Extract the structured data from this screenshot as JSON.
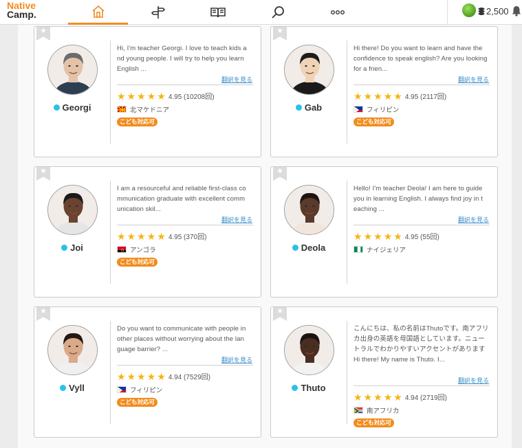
{
  "header": {
    "logo_line1": "Native",
    "logo_line2": "Camp.",
    "nav": [
      {
        "name": "home-icon",
        "active": true
      },
      {
        "name": "signpost-icon",
        "active": false
      },
      {
        "name": "book-icon",
        "active": false
      },
      {
        "name": "search-icon",
        "active": false
      },
      {
        "name": "more-icon",
        "active": false
      }
    ],
    "points": "2,500"
  },
  "teachers": [
    {
      "name": "Georgi",
      "description": "Hi, I'm teacher Georgi. I love to teach kids a nd young people. I will try to help you learn English ...",
      "translate": "翻訳を見る",
      "rating": "4.95 (10208回)",
      "country": "北マケドニア",
      "flag": "macedonia",
      "badge": "こども対応可"
    },
    {
      "name": "Gab",
      "description": "Hi there! Do you want to learn and have the confidence to speak english? Are you looking for a frien...",
      "translate": "翻訳を見る",
      "rating": "4.95 (2117回)",
      "country": "フィリピン",
      "flag": "philippines",
      "badge": "こども対応可"
    },
    {
      "name": "Joi",
      "description": "I am a resourceful and reliable first-class co mmunication graduate with excellent comm unication skil...",
      "translate": "翻訳を見る",
      "rating": "4.95 (370回)",
      "country": "アンゴラ",
      "flag": "angola",
      "badge": "こども対応可"
    },
    {
      "name": "Deola",
      "description": "Hello! I'm teacher Deola! I am here to guide you in learning English. I always find joy in t eaching ...",
      "translate": "翻訳を見る",
      "rating": "4.95 (55回)",
      "country": "ナイジェリア",
      "flag": "nigeria",
      "badge": ""
    },
    {
      "name": "Vyll",
      "description": "Do you want to communicate with people in other places without worrying about the lan guage barrier? ...",
      "translate": "翻訳を見る",
      "rating": "4.94 (7529回)",
      "country": "フィリピン",
      "flag": "philippines",
      "badge": "こども対応可"
    },
    {
      "name": "Thuto",
      "description": "こんにちは、私の名前はThutoです。南アフリカ出身の英語を母国語としています。ニュートラルでわかりやすいアクセントがあります Hi there! My name is Thuto. I...",
      "translate": "翻訳を見る",
      "rating": "4.94 (2719回)",
      "country": "南アフリカ",
      "flag": "southafrica",
      "badge": "こども対応可"
    }
  ],
  "colors": {
    "accent": "#f28c1e",
    "online_dot": "#26c2ec",
    "star": "#f5b412",
    "link": "#3a8ecb"
  }
}
